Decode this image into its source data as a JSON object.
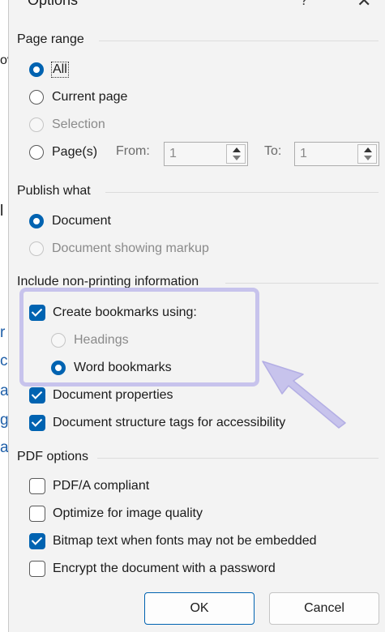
{
  "dialog": {
    "title": "Options",
    "help_glyph": "?",
    "close_glyph": "✕"
  },
  "page_range": {
    "heading": "Page range",
    "options": [
      "All",
      "Current page",
      "Selection",
      "Page(s)"
    ],
    "selected": "All",
    "from_label": "From:",
    "from_value": "1",
    "to_label": "To:",
    "to_value": "1"
  },
  "publish_what": {
    "heading": "Publish what",
    "options": [
      "Document",
      "Document showing markup"
    ],
    "selected": "Document"
  },
  "non_printing": {
    "heading": "Include non-printing information",
    "create_bookmarks": "Create bookmarks using:",
    "create_bookmarks_checked": true,
    "bookmark_options": [
      "Headings",
      "Word bookmarks"
    ],
    "bookmark_selected": "Word bookmarks",
    "document_properties": "Document properties",
    "structure_tags": "Document structure tags for accessibility"
  },
  "pdf_options": {
    "heading": "PDF options",
    "items": [
      {
        "label": "PDF/A compliant",
        "checked": false
      },
      {
        "label": "Optimize for image quality",
        "checked": false
      },
      {
        "label": "Bitmap text when fonts may not be embedded",
        "checked": true
      },
      {
        "label": "Encrypt the document with a password",
        "checked": false
      }
    ]
  },
  "buttons": {
    "ok": "OK",
    "cancel": "Cancel"
  },
  "background_text": [
    "ov",
    "l",
    "r",
    "c",
    "a",
    "g",
    "a"
  ],
  "colors": {
    "accent": "#0063b1",
    "annotation": "#c7c3ec"
  }
}
